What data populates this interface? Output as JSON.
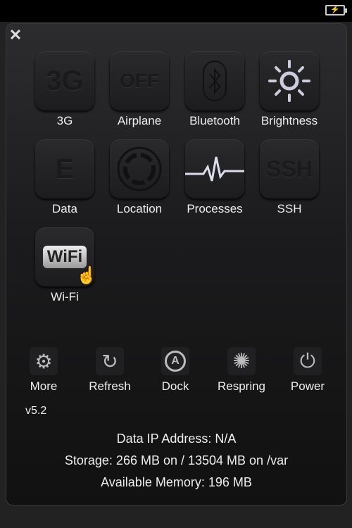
{
  "status": {
    "battery_icon": "battery-charging-icon"
  },
  "close_icon": "close-icon",
  "toggles": [
    {
      "label": "3G",
      "glyph": "3G"
    },
    {
      "label": "Airplane",
      "glyph": "OFF"
    },
    {
      "label": "Bluetooth",
      "glyph": "bluetooth-icon"
    },
    {
      "label": "Brightness",
      "glyph": "sun-icon"
    },
    {
      "label": "Data",
      "glyph": "E"
    },
    {
      "label": "Location",
      "glyph": "location-icon"
    },
    {
      "label": "Processes",
      "glyph": "pulse-icon"
    },
    {
      "label": "SSH",
      "glyph": "SSH"
    },
    {
      "label": "Wi-Fi",
      "glyph": "WiFi"
    }
  ],
  "actions": [
    {
      "label": "More",
      "icon": "gear-icon"
    },
    {
      "label": "Refresh",
      "icon": "refresh-icon"
    },
    {
      "label": "Dock",
      "icon": "app-store-icon"
    },
    {
      "label": "Respring",
      "icon": "spinner-icon"
    },
    {
      "label": "Power",
      "icon": "power-icon"
    }
  ],
  "version": "v5.2",
  "info": {
    "ip": "Data IP Address: N/A",
    "storage": "Storage: 266 MB on / 13504 MB on /var",
    "memory": "Available Memory: 196 MB"
  }
}
